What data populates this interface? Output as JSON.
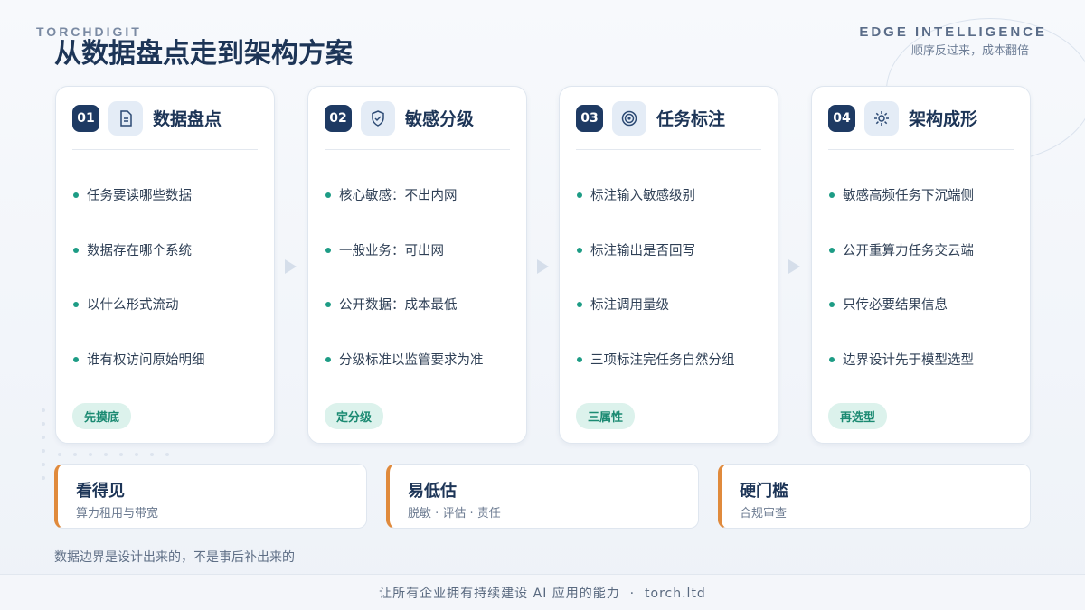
{
  "header": {
    "brand": "TORCHDIGIT",
    "title": "从数据盘点走到架构方案",
    "tagline": "EDGE INTELLIGENCE",
    "tagline_sub": "顺序反过来，成本翻倍"
  },
  "steps": [
    {
      "num": "01",
      "icon": "document-icon",
      "title": "数据盘点",
      "bullets": [
        "任务要读哪些数据",
        "数据存在哪个系统",
        "以什么形式流动",
        "谁有权访问原始明细"
      ],
      "tag": "先摸底"
    },
    {
      "num": "02",
      "icon": "shield-check-icon",
      "title": "敏感分级",
      "bullets": [
        "核心敏感：不出内网",
        "一般业务：可出网",
        "公开数据：成本最低",
        "分级标准以监管要求为准"
      ],
      "tag": "定分级"
    },
    {
      "num": "03",
      "icon": "target-icon",
      "title": "任务标注",
      "bullets": [
        "标注输入敏感级别",
        "标注输出是否回写",
        "标注调用量级",
        "三项标注完任务自然分组"
      ],
      "tag": "三属性"
    },
    {
      "num": "04",
      "icon": "sun-gear-icon",
      "title": "架构成形",
      "bullets": [
        "敏感高频任务下沉端侧",
        "公开重算力任务交云端",
        "只传必要结果信息",
        "边界设计先于模型选型"
      ],
      "tag": "再选型"
    }
  ],
  "principles": [
    {
      "title": "看得见",
      "subtitle": "算力租用与带宽"
    },
    {
      "title": "易低估",
      "subtitle": "脱敏 · 评估 · 责任"
    },
    {
      "title": "硬门槛",
      "subtitle": "合规审查"
    }
  ],
  "note": "数据边界是设计出来的，不是事后补出来的",
  "footer": "让所有企业拥有持续建设 AI 应用的能力  ·  torch.ltd",
  "colors": {
    "navy": "#1e3a63",
    "teal": "#1d9c85",
    "orange_accent": "#e08a3c"
  }
}
